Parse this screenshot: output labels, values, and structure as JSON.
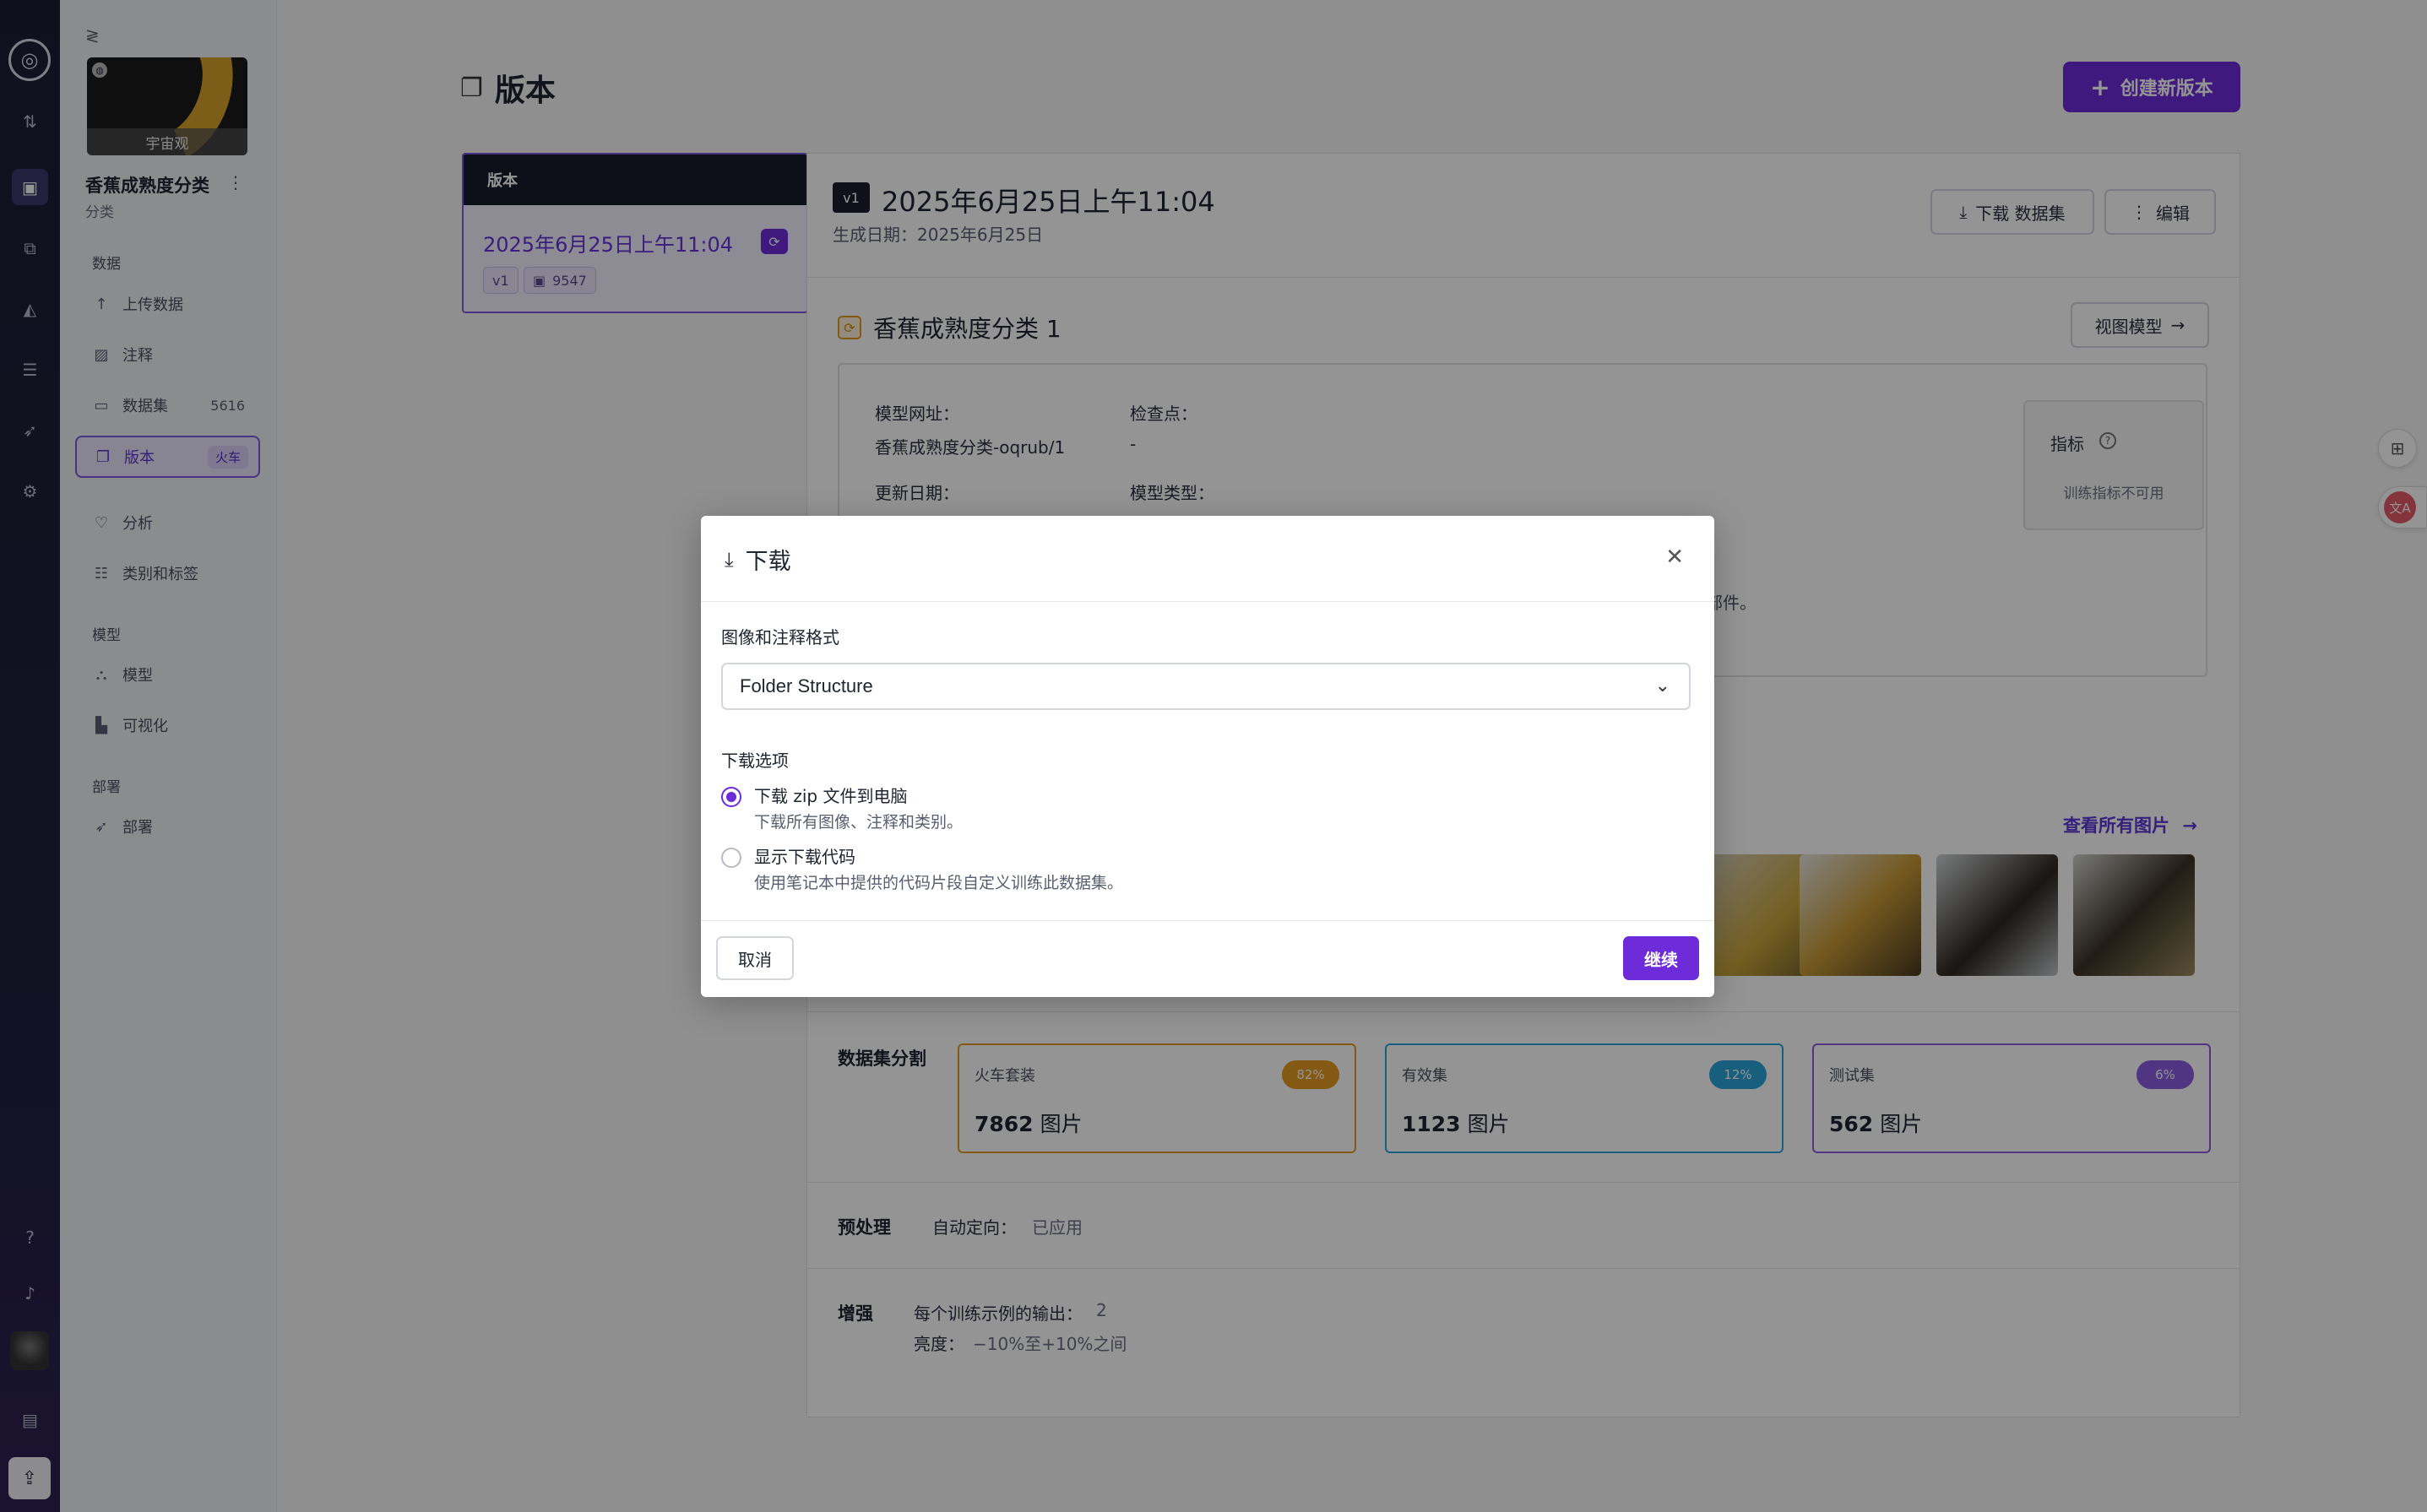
{
  "sidebar": {
    "collapse_icon": "collapse-icon",
    "project_thumb_caption": "宇宙观",
    "project_name": "香蕉成熟度分类",
    "project_type": "分类",
    "section_data": "数据",
    "section_model": "模型",
    "section_deploy": "部署",
    "items": {
      "upload": "上传数据",
      "annotate": "注释",
      "dataset": "数据集",
      "dataset_count": "5616",
      "versions": "版本",
      "versions_badge": "火车",
      "analysis": "分析",
      "classes": "类别和标签",
      "models": "模型",
      "visualize": "可视化",
      "deploy": "部署"
    }
  },
  "header": {
    "title": "版本",
    "create_button": "创建新版本"
  },
  "version_list": {
    "header": "版本",
    "selected_title": "2025年6月25日上午11:04",
    "tag": "v1",
    "image_count": "9547"
  },
  "detail": {
    "tag": "v1",
    "title": "2025年6月25日上午11:04",
    "subtitle": "生成日期：2025年6月25日",
    "download_button": "下载 数据集",
    "edit_button": "编辑",
    "model": {
      "name": "香蕉成熟度分类 1",
      "view_button": "视图模型",
      "url_label": "模型网址：",
      "url_value": "香蕉成熟度分类-oqrub/1",
      "checkpoint_label": "检查点：",
      "checkpoint_value": "-",
      "updated_label": "更新日期：",
      "type_label": "模型类型：",
      "metrics_title": "指标",
      "metrics_status": "训练指标不可用",
      "note": "部件。"
    },
    "see_all_images": "查看所有图片",
    "split": {
      "label": "数据集分割",
      "train": {
        "name": "火车套装",
        "pct": "82%",
        "count": "7862",
        "unit": "图片",
        "color": "#e39b22"
      },
      "valid": {
        "name": "有效集",
        "pct": "12%",
        "count": "1123",
        "unit": "图片",
        "color": "#2aa3d8"
      },
      "test": {
        "name": "测试集",
        "pct": "6%",
        "count": "562",
        "unit": "图片",
        "color": "#8a5ce0"
      }
    },
    "preprocess": {
      "label": "预处理",
      "key": "自动定向：",
      "value": "已应用"
    },
    "augment": {
      "label": "增强",
      "key1": "每个训练示例的输出：",
      "value1": "2",
      "key2": "亮度：",
      "value2": "−10%至+10%之间"
    }
  },
  "modal": {
    "title": "下载",
    "format_label": "图像和注释格式",
    "format_value": "Folder Structure",
    "options_label": "下载选项",
    "option1_title": "下载 zip 文件到电脑",
    "option1_desc": "下载所有图像、注释和类别。",
    "option2_title": "显示下载代码",
    "option2_desc": "使用笔记本中提供的代码片段自定义训练此数据集。",
    "cancel": "取消",
    "continue": "继续"
  },
  "colors": {
    "accent": "#6d2bd9",
    "rail": "#1c1d33"
  }
}
